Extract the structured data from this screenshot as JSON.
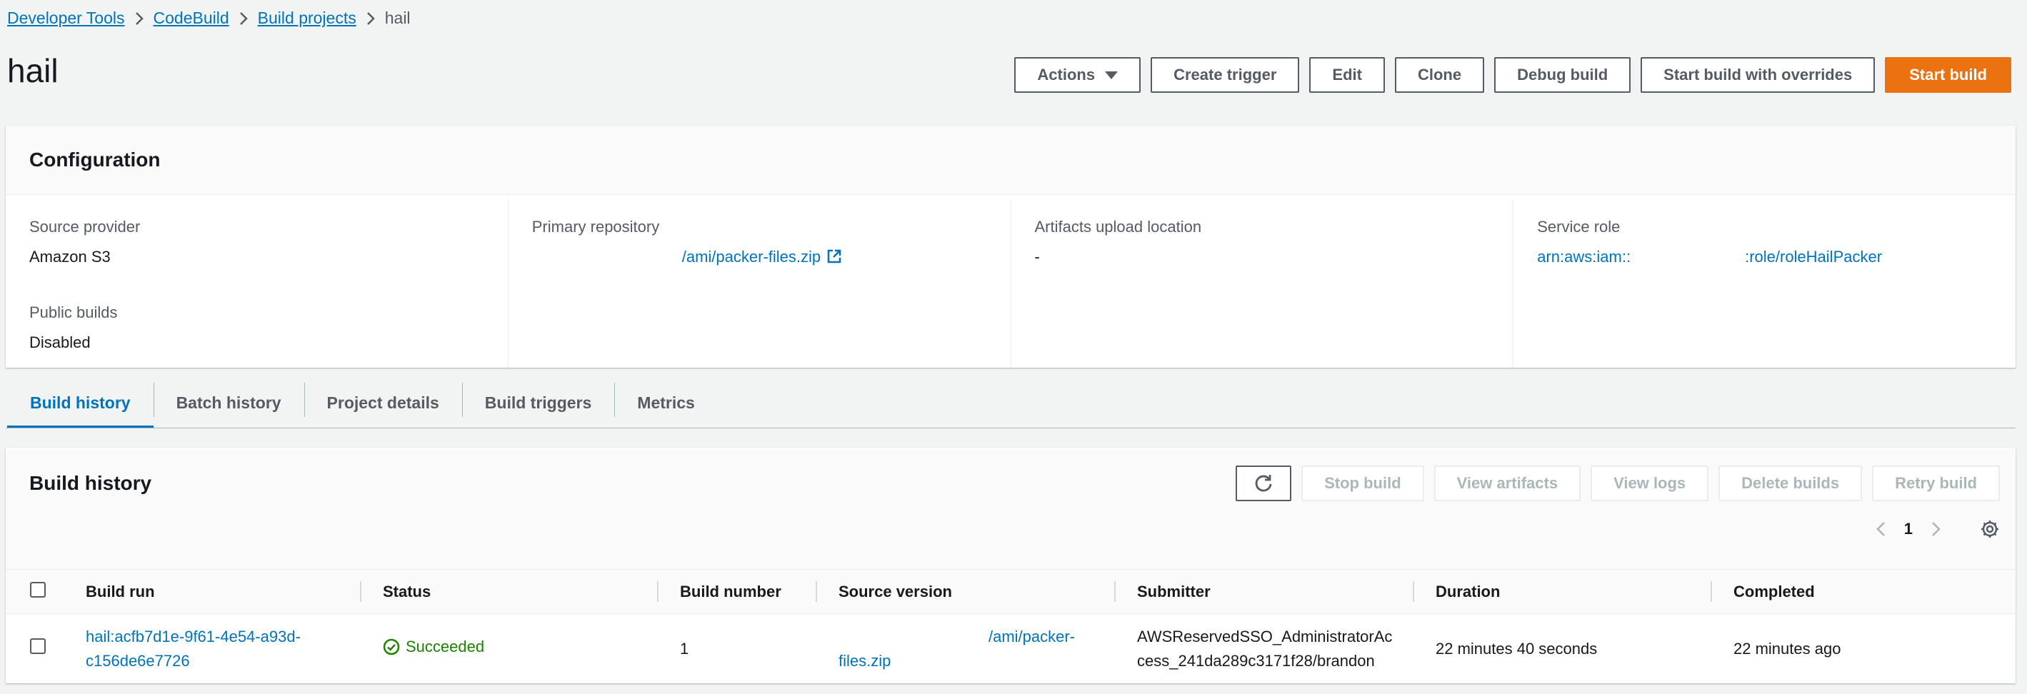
{
  "breadcrumb": [
    "Developer Tools",
    "CodeBuild",
    "Build projects",
    "hail"
  ],
  "page_title": "hail",
  "header_buttons": {
    "actions": "Actions",
    "create_trigger": "Create trigger",
    "edit": "Edit",
    "clone": "Clone",
    "debug_build": "Debug build",
    "start_with_overrides": "Start build with overrides",
    "start_build": "Start build"
  },
  "config": {
    "title": "Configuration",
    "source_provider_label": "Source provider",
    "source_provider_value": "Amazon S3",
    "public_builds_label": "Public builds",
    "public_builds_value": "Disabled",
    "primary_repo_label": "Primary repository",
    "primary_repo_value": "/ami/packer-files.zip",
    "artifacts_label": "Artifacts upload location",
    "artifacts_value": "-",
    "service_role_label": "Service role",
    "service_role_prefix": "arn:aws:iam::",
    "service_role_suffix": ":role/roleHailPacker"
  },
  "tabs": [
    "Build history",
    "Batch history",
    "Project details",
    "Build triggers",
    "Metrics"
  ],
  "history": {
    "title": "Build history",
    "buttons": {
      "stop": "Stop build",
      "view_artifacts": "View artifacts",
      "view_logs": "View logs",
      "delete": "Delete builds",
      "retry": "Retry build"
    },
    "page": "1",
    "columns": [
      "Build run",
      "Status",
      "Build number",
      "Source version",
      "Submitter",
      "Duration",
      "Completed"
    ],
    "rows": [
      {
        "build_run_line1": "hail:acfb7d1e-9f61-4e54-a93d-",
        "build_run_line2": "c156de6e7726",
        "status": "Succeeded",
        "build_number": "1",
        "source_line1": "/ami/packer-",
        "source_line2": "files.zip",
        "submitter_line1": "AWSReservedSSO_AdministratorAc",
        "submitter_line2": "cess_241da289c3171f28/brandon",
        "duration": "22 minutes 40 seconds",
        "completed": "22 minutes ago"
      }
    ]
  },
  "colors": {
    "link": "#0073bb",
    "primary_button": "#ec7211",
    "success": "#1d8102"
  }
}
